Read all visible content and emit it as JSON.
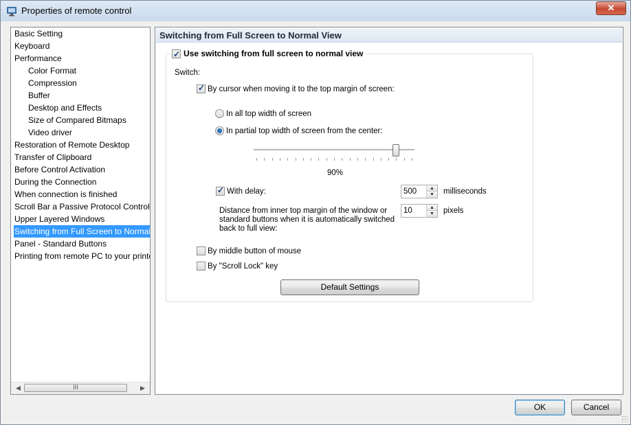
{
  "window": {
    "title": "Properties of remote control",
    "close_glyph": "✕"
  },
  "nav": {
    "items": [
      {
        "label": "Basic Setting",
        "sub": false
      },
      {
        "label": "Keyboard",
        "sub": false
      },
      {
        "label": "Performance",
        "sub": false
      },
      {
        "label": "Color Format",
        "sub": true
      },
      {
        "label": "Compression",
        "sub": true
      },
      {
        "label": "Buffer",
        "sub": true
      },
      {
        "label": "Desktop and Effects",
        "sub": true
      },
      {
        "label": "Size of Compared Bitmaps",
        "sub": true
      },
      {
        "label": "Video driver",
        "sub": true
      },
      {
        "label": "Restoration of Remote Desktop",
        "sub": false
      },
      {
        "label": "Transfer of Clipboard",
        "sub": false
      },
      {
        "label": "Before Control Activation",
        "sub": false
      },
      {
        "label": "During the Connection",
        "sub": false
      },
      {
        "label": "When connection is finished",
        "sub": false
      },
      {
        "label": "Scroll Bar a Passive Protocol Control",
        "sub": false
      },
      {
        "label": "Upper Layered Windows",
        "sub": false
      },
      {
        "label": "Switching from Full Screen to Normal View",
        "sub": false,
        "selected": true
      },
      {
        "label": "Panel - Standard Buttons",
        "sub": false
      },
      {
        "label": "Printing from remote PC to your printer",
        "sub": false
      }
    ],
    "scroll_left": "◀",
    "scroll_right": "▶",
    "scroll_grip": "III"
  },
  "panel": {
    "title": "Switching from Full Screen to Normal View",
    "use_switching": {
      "label": "Use switching from full screen to normal view",
      "checked": true
    },
    "switch_label": "Switch:",
    "by_cursor": {
      "label": "By cursor when moving it to the top margin of screen:",
      "checked": true
    },
    "radio_all": {
      "label": "In all top width of screen",
      "checked": false
    },
    "radio_partial": {
      "label": "In partial top width of screen from the center:",
      "checked": true
    },
    "slider": {
      "value_percent": 90,
      "label": "90%"
    },
    "with_delay": {
      "label": "With delay:",
      "checked": true
    },
    "delay": {
      "value": "500",
      "unit": "milliseconds"
    },
    "distance": {
      "label_line1": "Distance from inner top margin of the window or",
      "label_line2": "standard buttons when it is automatically switched",
      "label_line3": "back to full view:",
      "value": "10",
      "unit": "pixels"
    },
    "by_middle": {
      "label": "By middle button of mouse",
      "checked": false
    },
    "by_scroll_lock": {
      "label": "By \"Scroll Lock\" key",
      "checked": false
    },
    "default_settings": "Default Settings"
  },
  "footer": {
    "ok": "OK",
    "cancel": "Cancel"
  }
}
